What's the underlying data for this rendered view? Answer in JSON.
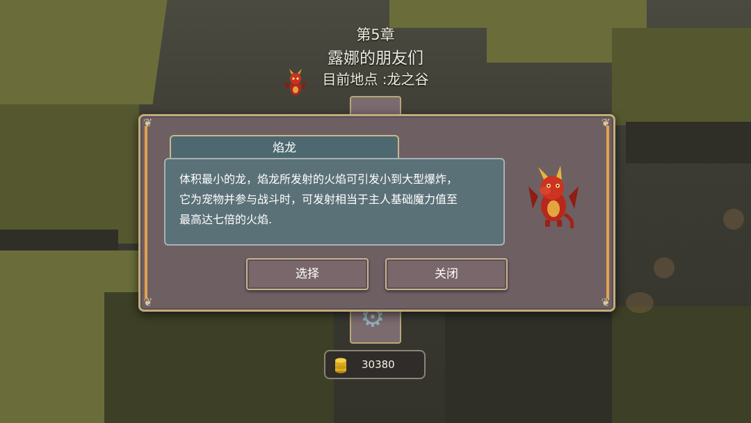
{
  "header": {
    "chapter": "第5章",
    "chapter_title": "露娜的朋友们",
    "location": "目前地点 :龙之谷"
  },
  "pet_dialog": {
    "name": "焰龙",
    "description_lines": [
      "体积最小的龙，焰龙所发射的火焰可引发小到大型爆炸，",
      "它为宠物并参与战斗时，可发射相当于主人基础魔力值至",
      "最高达七倍的火焰."
    ],
    "select_label": "选择",
    "close_label": "关闭"
  },
  "currency": {
    "amount": "30380",
    "icon": "gold-coin-stack-icon"
  },
  "colors": {
    "dialog_bg": "#6e5f63",
    "dialog_border": "#c2ad7d",
    "panel_teal": "#5b7178",
    "accent_orange": "#e3a351"
  }
}
